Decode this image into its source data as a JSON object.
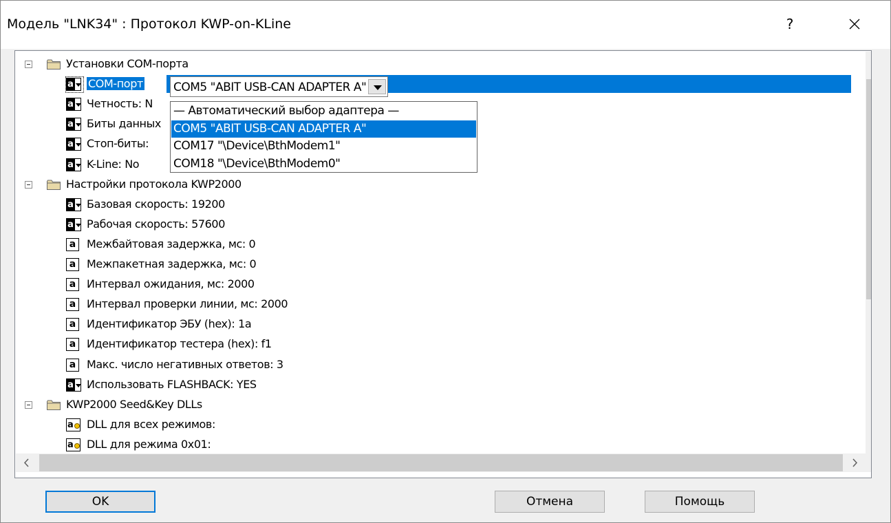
{
  "window": {
    "title": "Модель \"LNK34\" : Протокол KWP-on-KLine",
    "help_label": "?"
  },
  "tree": {
    "groups": [
      {
        "label": "Установки COM-порта",
        "items": [
          {
            "label": "COM-порт",
            "icon": "combo-param-icon",
            "selected": true
          },
          {
            "label": "Четность: N",
            "icon": "combo-param-icon"
          },
          {
            "label": "Биты данных",
            "icon": "combo-param-icon"
          },
          {
            "label": "Стоп-биты:",
            "icon": "combo-param-icon"
          },
          {
            "label": "K-Line: No",
            "icon": "combo-param-icon"
          }
        ]
      },
      {
        "label": "Настройки протокола KWP2000",
        "items": [
          {
            "label": "Базовая скорость: 19200",
            "icon": "combo-param-icon"
          },
          {
            "label": "Рабочая скорость: 57600",
            "icon": "combo-param-icon"
          },
          {
            "label": "Межбайтовая задержка, мс: 0",
            "icon": "text-param-icon"
          },
          {
            "label": "Межпакетная задержка, мс: 0",
            "icon": "text-param-icon"
          },
          {
            "label": "Интервал ожидания, мс: 2000",
            "icon": "text-param-icon"
          },
          {
            "label": "Интервал проверки линии, мс: 2000",
            "icon": "text-param-icon"
          },
          {
            "label": "Идентификатор ЭБУ (hex): 1a",
            "icon": "text-param-icon"
          },
          {
            "label": "Идентификатор тестера (hex): f1",
            "icon": "text-param-icon"
          },
          {
            "label": "Макс. число негативных ответов: 3",
            "icon": "text-param-icon"
          },
          {
            "label": "Использовать FLASHBACK: YES",
            "icon": "combo-param-icon"
          }
        ]
      },
      {
        "label": "KWP2000 Seed&Key DLLs",
        "items": [
          {
            "label": "DLL для всех режимов:",
            "icon": "dll-param-icon"
          },
          {
            "label": "DLL для режима 0x01:",
            "icon": "dll-param-icon"
          }
        ]
      }
    ]
  },
  "combo": {
    "value": "COM5  \"ABIT USB-CAN ADAPTER A\"",
    "options": [
      "— Автоматический выбор адаптера —",
      "COM5  \"ABIT USB-CAN ADAPTER A\"",
      "COM17  \"\\Device\\BthModem1\"",
      "COM18  \"\\Device\\BthModem0\""
    ],
    "selected_index": 1
  },
  "buttons": {
    "ok": "OK",
    "cancel": "Отмена",
    "help": "Помощь"
  },
  "colors": {
    "selection": "#0078d7",
    "folder": "#e8d9a8"
  }
}
